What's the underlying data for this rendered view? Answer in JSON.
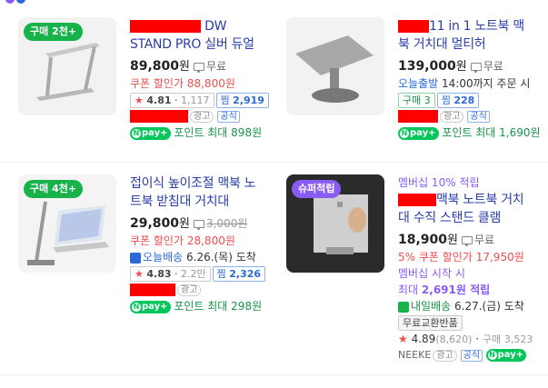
{
  "items": [
    {
      "badge": "구매 2천+",
      "title_pre": "",
      "title_rest": " DW STAND PRO 실버 듀얼 노",
      "price": "89,800",
      "won": "원",
      "shipping": "무료",
      "coupon_label": "쿠폰 할인가",
      "coupon_price": "88,800원",
      "rating": "4.81",
      "reviews": "1,117",
      "zzim_label": "찜",
      "zzim": "2,919",
      "ad": "광고",
      "official": "공식",
      "npay": "pay+",
      "point_label": "포인트 최대",
      "point": "898원"
    },
    {
      "badge": "",
      "title_pre": "",
      "title_rest": "11 in 1 노트북 맥북 거치대 멀티허",
      "price": "139,000",
      "won": "원",
      "shipping": "무료",
      "today": "오늘출발",
      "today_info": "14:00까지 주문 시",
      "buy_label": "구매 3",
      "zzim_label": "찜",
      "zzim": "228",
      "ad": "광고",
      "official": "공식",
      "npay": "pay+",
      "point_label": "포인트 최대",
      "point": "1,690원"
    },
    {
      "badge": "구매 4천+",
      "title": "접이식 높이조절 맥북 노트북 받침대 거치대",
      "price": "29,800",
      "won": "원",
      "shipping": "3,000원",
      "coupon_label": "쿠폰 할인가",
      "coupon_price": "28,800원",
      "delivery_name": "오늘배송",
      "delivery_date": "6.26.(목) 도착",
      "rating": "4.83",
      "reviews": "2.2만",
      "zzim_label": "찜",
      "zzim": "2,326",
      "ad": "광고",
      "npay": "pay+",
      "point_label": "포인트 최대",
      "point": "298원"
    },
    {
      "badge": "슈퍼적립",
      "member_rate": "멤버십 10% 적립",
      "title_rest": "맥북 노트북 거치대 수직 스탠드 클램",
      "price": "18,900",
      "won": "원",
      "shipping": "무료",
      "coupon_pct": "5%",
      "coupon_label": "쿠폰 할인가",
      "coupon_price": "17,950원",
      "member_start": "멤버십 시작 시",
      "member_max_label": "최대",
      "member_max": "2,691원 적립",
      "delivery_name": "내일배송",
      "delivery_date": "6.27.(금) 도착",
      "chip": "무료교환반품",
      "rating": "4.89",
      "reviews": "(8,620)",
      "buy_label": "구매",
      "buy_count": "3,523",
      "seller": "NEEKE",
      "ad": "광고",
      "official": "공식",
      "npay": "pay+"
    }
  ]
}
